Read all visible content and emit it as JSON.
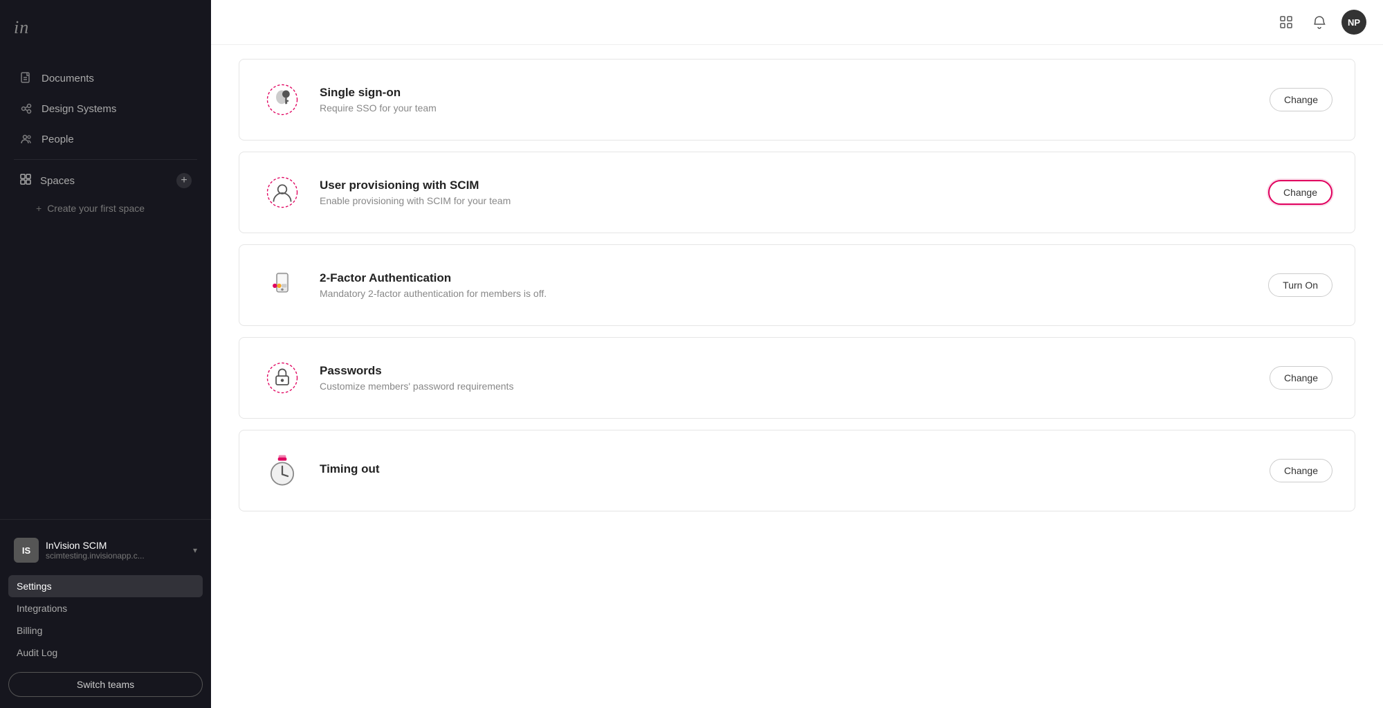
{
  "sidebar": {
    "logo": "in",
    "nav": [
      {
        "id": "documents",
        "label": "Documents"
      },
      {
        "id": "design-systems",
        "label": "Design Systems"
      },
      {
        "id": "people",
        "label": "People"
      }
    ],
    "spaces_label": "Spaces",
    "create_space_label": "Create your first space",
    "team": {
      "initials": "IS",
      "name": "InVision SCIM",
      "url": "scimtesting.invisionapp.c..."
    },
    "menu_items": [
      {
        "id": "settings",
        "label": "Settings",
        "active": true
      },
      {
        "id": "integrations",
        "label": "Integrations"
      },
      {
        "id": "billing",
        "label": "Billing"
      },
      {
        "id": "audit-log",
        "label": "Audit Log"
      }
    ],
    "switch_teams_label": "Switch teams"
  },
  "topbar": {
    "user_initials": "NP"
  },
  "settings": {
    "cards": [
      {
        "id": "sso",
        "title": "Single sign-on",
        "description": "Require SSO for your team",
        "action_label": "Change",
        "action_type": "change",
        "highlighted": false
      },
      {
        "id": "scim",
        "title": "User provisioning with SCIM",
        "description": "Enable provisioning with SCIM for your team",
        "action_label": "Change",
        "action_type": "change",
        "highlighted": true
      },
      {
        "id": "2fa",
        "title": "2-Factor Authentication",
        "description": "Mandatory 2-factor authentication for members is off.",
        "action_label": "Turn On",
        "action_type": "turnon",
        "highlighted": false
      },
      {
        "id": "passwords",
        "title": "Passwords",
        "description": "Customize members' password requirements",
        "action_label": "Change",
        "action_type": "change",
        "highlighted": false
      },
      {
        "id": "timeout",
        "title": "Timing out",
        "description": "",
        "action_label": "Change",
        "action_type": "change",
        "highlighted": false
      }
    ]
  }
}
